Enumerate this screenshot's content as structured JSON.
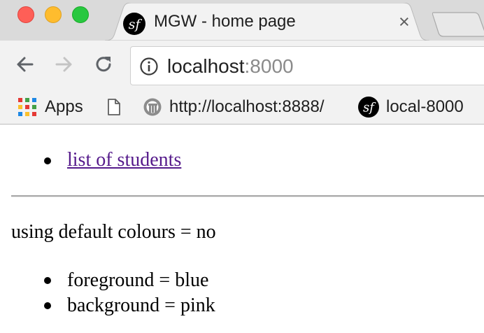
{
  "tab": {
    "title": "MGW - home page",
    "close_glyph": "×",
    "favicon": "symfony-icon"
  },
  "toolbar": {
    "back_icon": "arrow-left-icon",
    "forward_icon": "arrow-right-icon",
    "reload_icon": "reload-icon"
  },
  "omnibox": {
    "info_icon": "info-icon",
    "host": "localhost",
    "port": ":8000"
  },
  "bookmarks": [
    {
      "label": "Apps",
      "icon": "apps-grid-icon"
    },
    {
      "label": "",
      "icon": "page-icon"
    },
    {
      "label": "http://localhost:8888/",
      "icon": "globe-icon"
    },
    {
      "label": "local-8000",
      "icon": "symfony-icon"
    }
  ],
  "apps_colors": [
    "#e53935",
    "#43a047",
    "#1e88e5",
    "#fbc02d",
    "#e53935",
    "#43a047",
    "#1e88e5",
    "#fbc02d",
    "#e53935"
  ],
  "content": {
    "links": [
      "list of students"
    ],
    "defaults_line": "using default colours = no",
    "colours": [
      "foreground = blue",
      "background = pink"
    ]
  },
  "colors": {
    "link_visited": "#551a8b",
    "close_red": "#fe5f57",
    "minimize_yellow": "#febc2e",
    "maximize_green": "#28c840"
  }
}
